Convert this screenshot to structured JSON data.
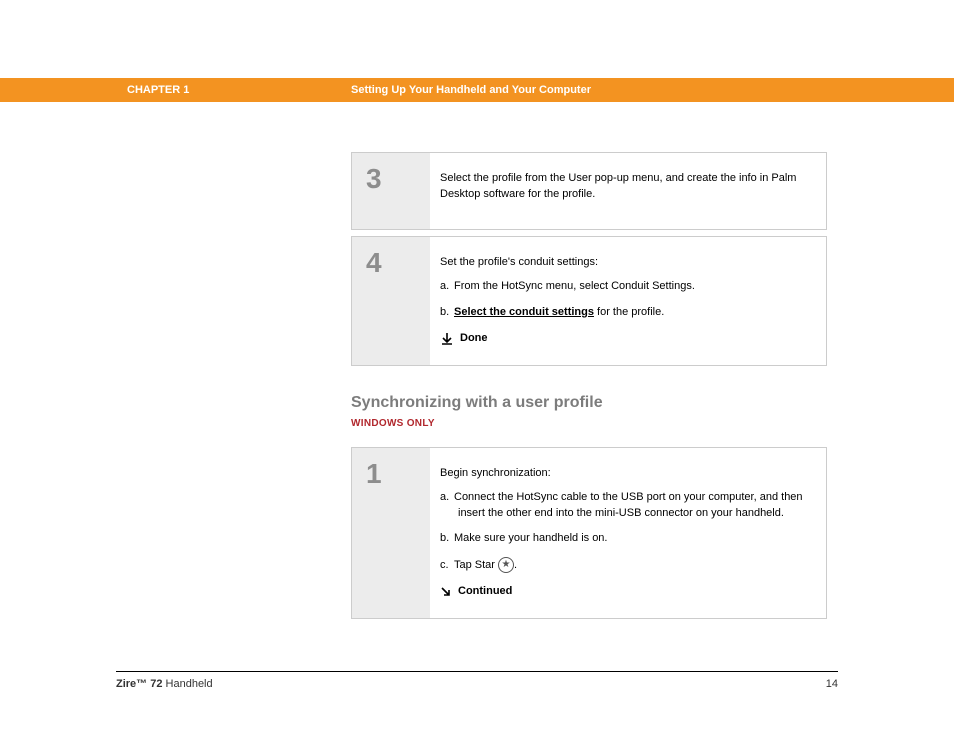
{
  "header": {
    "chapter": "CHAPTER 1",
    "title": "Setting Up Your Handheld and Your Computer"
  },
  "steps_top": [
    {
      "num": "3",
      "text": "Select the profile from the User pop-up menu, and create the info in Palm Desktop software for the profile."
    },
    {
      "num": "4",
      "intro": "Set the profile's conduit settings:",
      "a": "From the HotSync menu, select Conduit Settings.",
      "b_link": "Select the conduit settings",
      "b_rest": " for the profile.",
      "done": "Done"
    }
  ],
  "section": {
    "title": "Synchronizing with a user profile",
    "badge": "WINDOWS ONLY"
  },
  "step_sync": {
    "num": "1",
    "intro": "Begin synchronization:",
    "a": "Connect the HotSync cable to the USB port on your computer, and then insert the other end into the mini-USB connector on your handheld.",
    "b": "Make sure your handheld is on.",
    "c_pre": "Tap Star ",
    "c_post": ".",
    "continued": "Continued"
  },
  "footer": {
    "product_bold": "Zire™ 72",
    "product_rest": " Handheld",
    "page": "14"
  }
}
